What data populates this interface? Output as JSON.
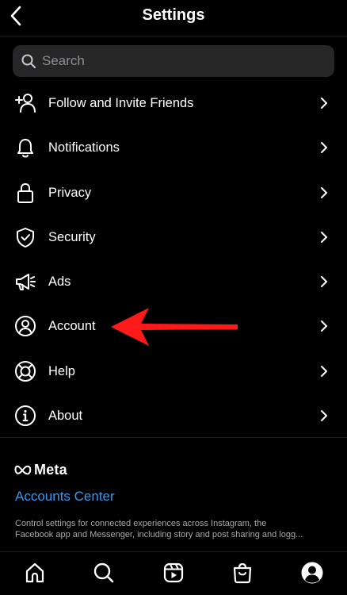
{
  "header": {
    "title": "Settings"
  },
  "search": {
    "placeholder": "Search"
  },
  "menu": [
    {
      "label": "Follow and Invite Friends",
      "icon": "add-person-icon"
    },
    {
      "label": "Notifications",
      "icon": "bell-icon"
    },
    {
      "label": "Privacy",
      "icon": "lock-icon"
    },
    {
      "label": "Security",
      "icon": "shield-check-icon"
    },
    {
      "label": "Ads",
      "icon": "megaphone-icon"
    },
    {
      "label": "Account",
      "icon": "person-circle-icon"
    },
    {
      "label": "Help",
      "icon": "lifebuoy-icon"
    },
    {
      "label": "About",
      "icon": "info-icon"
    }
  ],
  "meta": {
    "logo_text": "Meta",
    "accounts_center": "Accounts Center",
    "description_line1": "Control settings for connected experiences across Instagram, the",
    "description_line2": "Facebook app and Messenger, including story and post sharing and logg..."
  },
  "tabbar": [
    {
      "icon": "home-icon"
    },
    {
      "icon": "search-icon"
    },
    {
      "icon": "reels-icon"
    },
    {
      "icon": "shop-icon"
    },
    {
      "icon": "profile-icon"
    }
  ],
  "colors": {
    "background": "#000000",
    "search_bg": "#262626",
    "link": "#3897f0",
    "annotation_arrow": "#ff1a1a"
  }
}
